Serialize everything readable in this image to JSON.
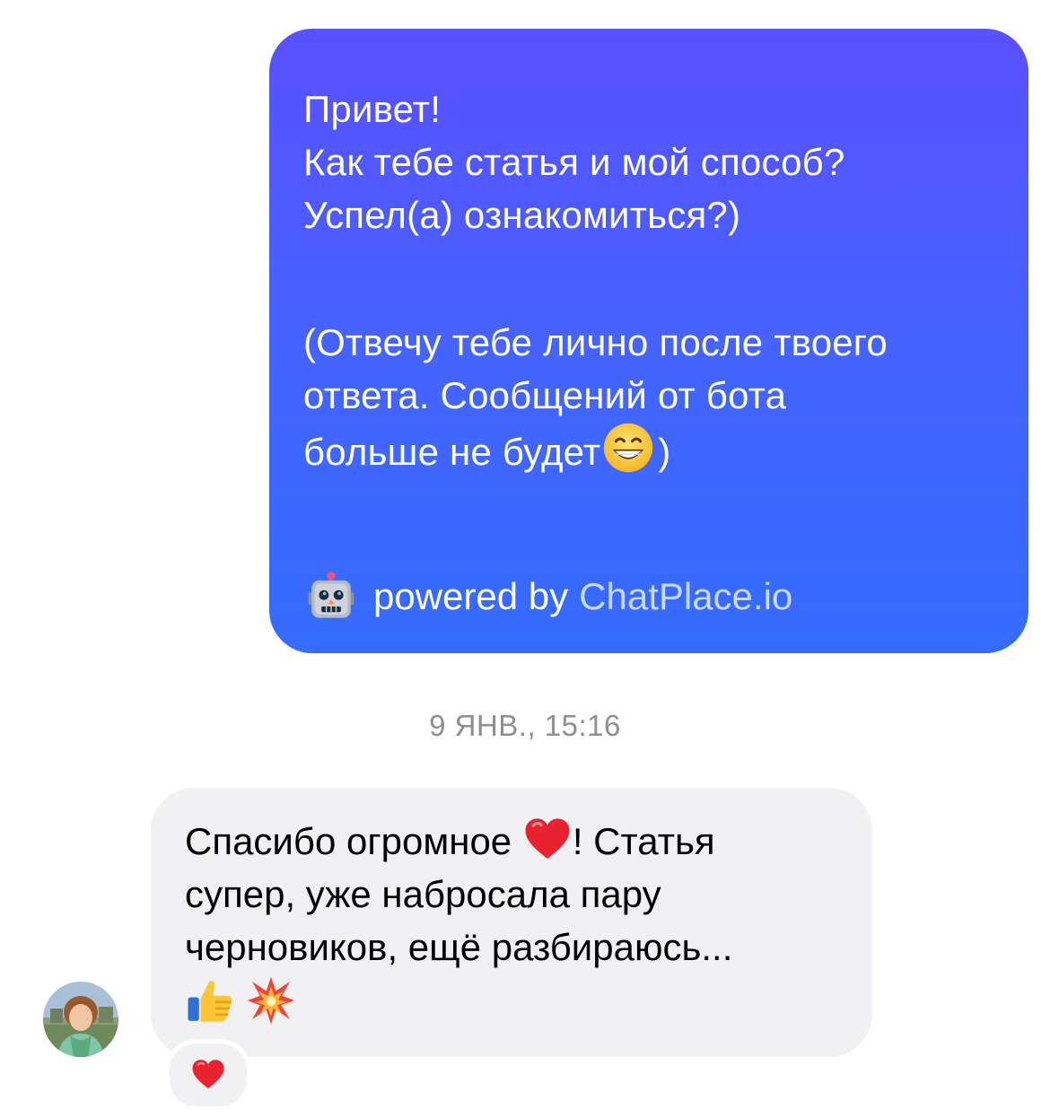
{
  "outgoing_message": {
    "lines": [
      "Привет!",
      "Как тебе статья и мой способ?",
      "Успел(а) ознакомиться?)",
      "(Отвечу тебе лично после твоего",
      "ответа. Сообщений от бота",
      "больше не будет",
      ")"
    ],
    "powered_prefix": "powered by",
    "powered_brand": "ChatPlace.io",
    "emoji_grin": "grinning-face-icon",
    "emoji_robot": "robot-icon"
  },
  "timestamp": "9 ЯНВ., 15:16",
  "incoming_message": {
    "lines": [
      "Спасибо огромное",
      "! Статья",
      "супер, уже набросала пару",
      "черновиков, ещё разбираюсь..."
    ],
    "emojis": [
      "red-heart-icon",
      "thumbs-up-icon",
      "collision-icon"
    ]
  },
  "reaction": "red-heart-icon",
  "colors": {
    "outgoing_top": "#5950ff",
    "outgoing_bottom": "#356cff",
    "incoming_bg": "#f1f1f3",
    "timestamp": "#8e8e93"
  }
}
